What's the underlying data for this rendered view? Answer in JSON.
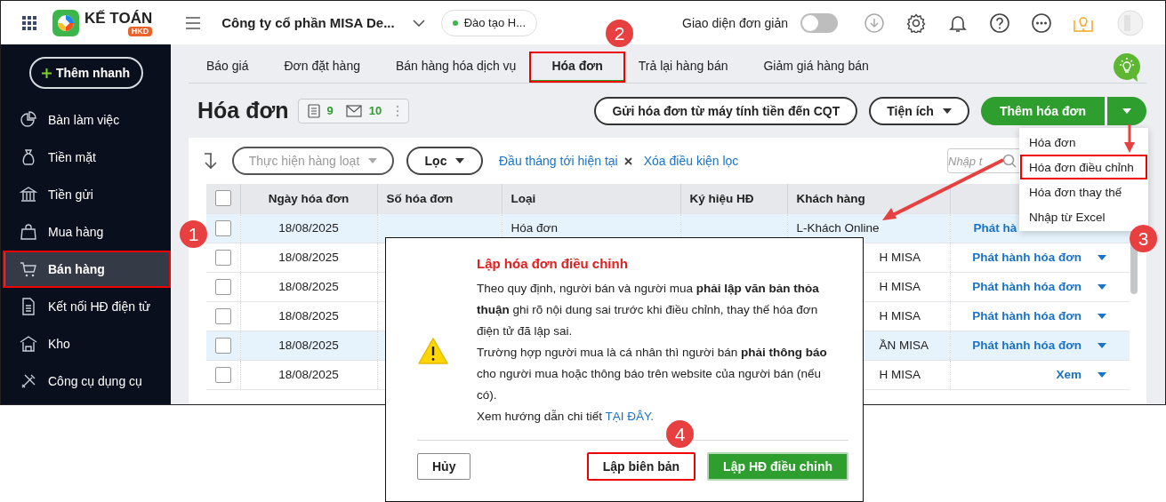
{
  "header": {
    "brand": "KẾ TOÁN",
    "brand_badge": "HKD",
    "company": "Công ty cổ phần MISA De...",
    "branch": "Đào tạo H...",
    "simple_mode": {
      "label": "Giao diện đơn giản",
      "on": false
    }
  },
  "sidebar": {
    "quick_add": "Thêm nhanh",
    "items": [
      {
        "label": "Bàn làm việc",
        "selected": false,
        "highlighted": false
      },
      {
        "label": "Tiền mặt",
        "selected": false,
        "highlighted": false
      },
      {
        "label": "Tiền gửi",
        "selected": false,
        "highlighted": false
      },
      {
        "label": "Mua hàng",
        "selected": false,
        "highlighted": false
      },
      {
        "label": "Bán hàng",
        "selected": true,
        "highlighted": true
      },
      {
        "label": "Kết nối HĐ điện tử",
        "selected": false,
        "highlighted": false
      },
      {
        "label": "Kho",
        "selected": false,
        "highlighted": false
      },
      {
        "label": "Công cụ dụng cụ",
        "selected": false,
        "highlighted": false
      }
    ]
  },
  "tabs": [
    {
      "label": "Báo giá",
      "selected": false,
      "highlighted": false
    },
    {
      "label": "Đơn đặt hàng",
      "selected": false,
      "highlighted": false
    },
    {
      "label": "Bán hàng hóa dịch vụ",
      "selected": false,
      "highlighted": false
    },
    {
      "label": "Hóa đơn",
      "selected": true,
      "highlighted": true
    },
    {
      "label": "Trả lại hàng bán",
      "selected": false,
      "highlighted": false
    },
    {
      "label": "Giảm giá hàng bán",
      "selected": false,
      "highlighted": false
    }
  ],
  "page": {
    "title": "Hóa đơn",
    "counters": [
      "9",
      "10"
    ],
    "buttons": [
      {
        "label": "Gửi hóa đơn từ máy tính tiền đến CQT",
        "kind": "outline"
      },
      {
        "label": "Tiện ích",
        "kind": "menu"
      },
      {
        "label": "Thêm hóa đơn",
        "kind": "split"
      }
    ]
  },
  "toolbar": {
    "bulk_action": {
      "label": "Thực hiện hàng loạt",
      "disabled": true
    },
    "filter_button": "Lọc",
    "filter_chip": "Đầu tháng tới hiện tại",
    "clear_filter": "Xóa điều kiện lọc",
    "search": {
      "placeholder": "Nhập t"
    }
  },
  "table": {
    "all_checked": false,
    "columns": [
      "Ngày hóa đơn",
      "Số hóa đơn",
      "Loại",
      "Ký hiệu HĐ",
      "Khách hàng"
    ],
    "rows": [
      {
        "checked": false,
        "selected": true,
        "date": "18/08/2025",
        "type": "Hóa đơn",
        "customer": "L-Khách Online",
        "action": "Phát hà"
      },
      {
        "checked": false,
        "selected": false,
        "date": "18/08/2025",
        "customer": "H MISA",
        "action": "Phát hành hóa đơn"
      },
      {
        "checked": false,
        "selected": false,
        "date": "18/08/2025",
        "customer": "H MISA",
        "action": "Phát hành hóa đơn"
      },
      {
        "checked": false,
        "selected": false,
        "date": "18/08/2025",
        "customer": "H MISA",
        "action": "Phát hành hóa đơn"
      },
      {
        "checked": false,
        "selected": true,
        "date": "18/08/2025",
        "customer": "ẦN MISA",
        "action": "Phát hành hóa đơn"
      },
      {
        "checked": false,
        "selected": false,
        "date": "18/08/2025",
        "customer": "H MISA",
        "action": "Xem"
      }
    ]
  },
  "add_menu": {
    "items": [
      {
        "label": "Hóa đơn",
        "highlighted": false
      },
      {
        "label": "Hóa đơn điều chỉnh",
        "highlighted": true
      },
      {
        "label": "Hóa đơn thay thế",
        "highlighted": false
      },
      {
        "label": "Nhập từ Excel",
        "highlighted": false
      }
    ]
  },
  "dialog": {
    "title": "Lập hóa đơn điều chỉnh",
    "paragraphs": [
      "Theo quy định, người bán và người mua **phải lập văn bản thỏa thuận** ghi rõ nội dung sai trước khi điều chỉnh, thay thế hóa đơn điện tử đã lập sai.",
      "Trường hợp người mua là cá nhân thì người bán **phải thông báo** cho người mua hoặc thông báo trên website của người bán (nếu có)."
    ],
    "guide_text": "Xem hướng dẫn chi tiết",
    "guide_link": "TẠI ĐÂY.",
    "buttons": [
      {
        "label": "Hủy",
        "kind": "secondary",
        "highlighted": false
      },
      {
        "label": "Lập biên bản",
        "kind": "secondary",
        "highlighted": true
      },
      {
        "label": "Lập HĐ điều chỉnh",
        "kind": "primary",
        "highlighted": false
      }
    ]
  },
  "callouts": [
    "1",
    "2",
    "3",
    "4"
  ]
}
